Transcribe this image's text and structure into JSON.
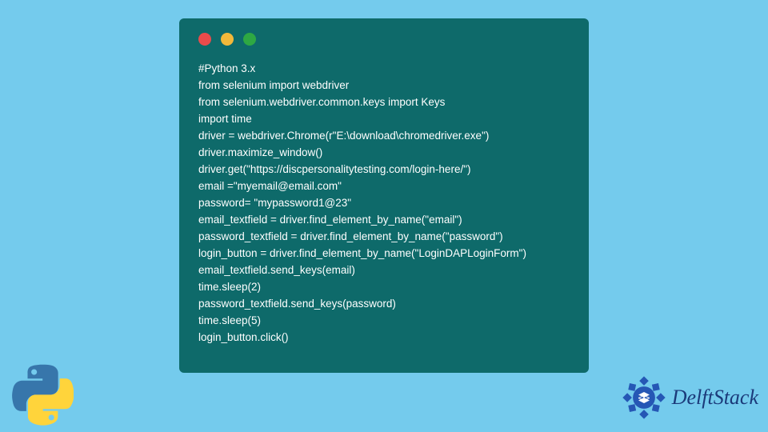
{
  "code": {
    "lines": [
      "#Python 3.x",
      "from selenium import webdriver",
      "from selenium.webdriver.common.keys import Keys",
      "import time",
      "driver = webdriver.Chrome(r\"E:\\download\\chromedriver.exe\")",
      "driver.maximize_window()",
      "driver.get(\"https://discpersonalitytesting.com/login-here/\")",
      "email =\"myemail@email.com\"",
      "password= \"mypassword1@23\"",
      "email_textfield = driver.find_element_by_name(\"email\")",
      "password_textfield = driver.find_element_by_name(\"password\")",
      "login_button = driver.find_element_by_name(\"LoginDAPLoginForm\")",
      "email_textfield.send_keys(email)",
      "time.sleep(2)",
      "password_textfield.send_keys(password)",
      "time.sleep(5)",
      "login_button.click()"
    ]
  },
  "branding": {
    "site_name": "DelftStack"
  },
  "window": {
    "dot_colors": {
      "red": "#e94b4b",
      "yellow": "#f2b83a",
      "green": "#2ea843"
    }
  }
}
